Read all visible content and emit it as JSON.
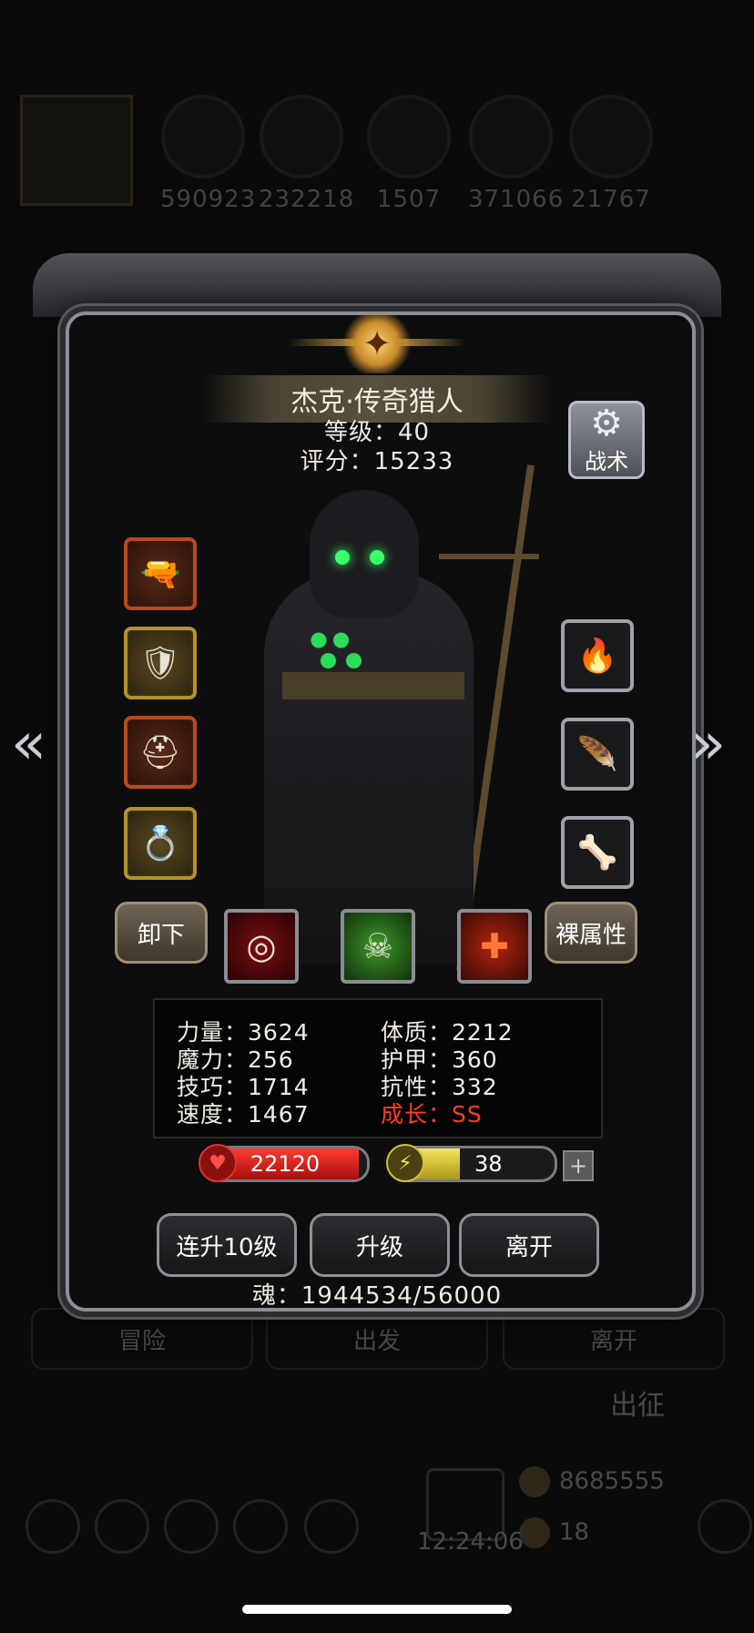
{
  "background": {
    "resources": [
      "590923",
      "232218",
      "1507",
      "371066",
      "21767"
    ],
    "bottom_tabs": [
      "冒险",
      "出发",
      "离开"
    ],
    "expedition": "出征",
    "coins": [
      "8685555",
      "18"
    ],
    "clock": "12:24:06"
  },
  "hero": {
    "name": "杰克·传奇猎人",
    "level_label": "等级：",
    "level": "40",
    "score_label": "评分：",
    "score": "15233"
  },
  "tactics_label": "战术",
  "equipment": {
    "left": [
      "pistol-icon",
      "chest-armor-icon",
      "helmet-icon",
      "ring-icon"
    ],
    "right": [
      "fire-gem-icon",
      "feather-gem-icon",
      "claw-gem-icon"
    ]
  },
  "buttons": {
    "unequip": "卸下",
    "base_attributes": "裸属性",
    "level_up_10": "连升10级",
    "level_up": "升级",
    "leave": "离开"
  },
  "skills": [
    "crosshair-skill-icon",
    "skull-skill-icon",
    "heal-cross-skill-icon"
  ],
  "stats": {
    "strength": "力量：3624",
    "magic": "魔力：256",
    "skill": "技巧：1714",
    "speed": "速度：1467",
    "constitution": "体质：2212",
    "armor": "护甲：360",
    "resistance": "抗性：332",
    "growth": "成长：SS"
  },
  "hp": {
    "value": "22120",
    "fill_fraction": 0.95
  },
  "energy": {
    "value": "38",
    "fill_fraction": 0.42
  },
  "soul": "魂：1944534/56000",
  "colors": {
    "hp": "#e0231c",
    "energy": "#e3d43a",
    "growth": "#ff3b22",
    "slot_orange": "#b74a22",
    "slot_gold": "#b39230"
  }
}
